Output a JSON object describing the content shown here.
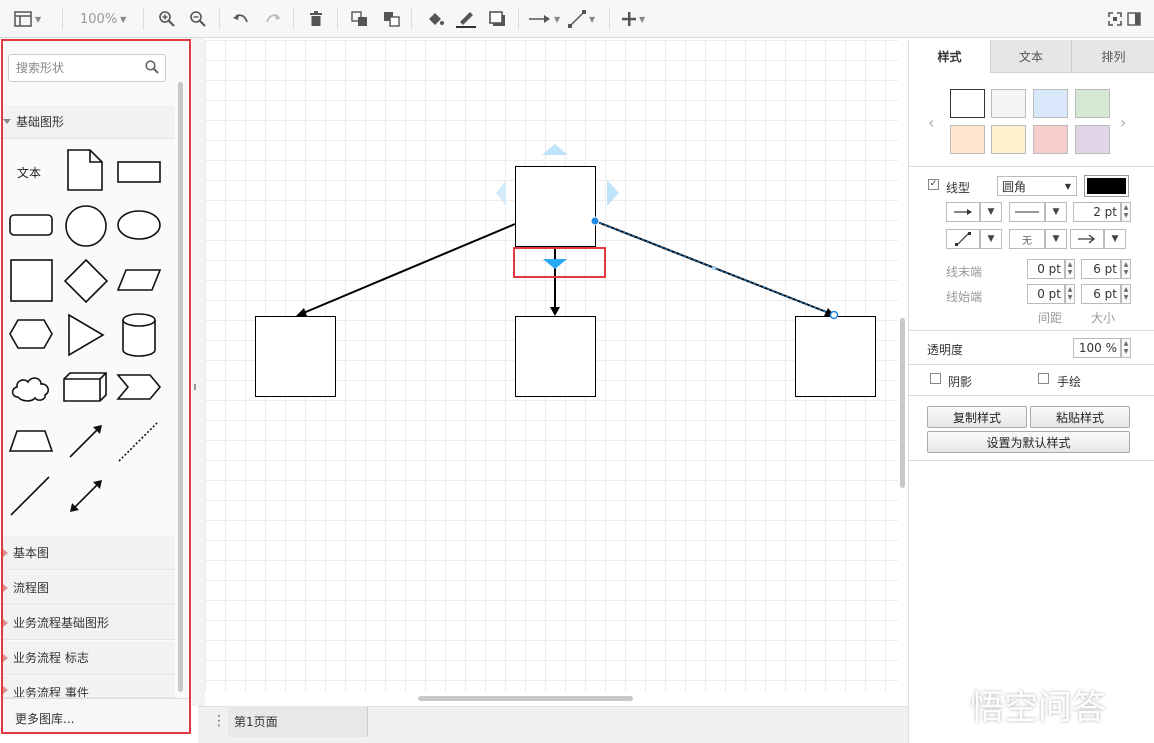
{
  "toolbar": {
    "zoom": "100%",
    "items": [
      "view-icon",
      "zoom-in-icon",
      "zoom-out-icon",
      "undo-icon",
      "redo-icon",
      "delete-icon",
      "to-front-icon",
      "to-back-icon",
      "fill-color-icon",
      "line-color-icon",
      "shadow-icon",
      "connection-icon",
      "waypoints-icon",
      "insert-icon",
      "fullscreen-icon",
      "format-panel-icon"
    ]
  },
  "left": {
    "search_placeholder": "搜索形状",
    "section_open": "基础图形",
    "text_shape": "文本",
    "sections": [
      "基本图",
      "流程图",
      "业务流程基础图形",
      "业务流程 标志",
      "业务流程 事件"
    ],
    "more": "更多图库..."
  },
  "bottom": {
    "page_tab": "第1页面"
  },
  "right": {
    "tabs": [
      "样式",
      "文本",
      "排列"
    ],
    "swatches": [
      "#ffffff",
      "#f5f5f5",
      "#dae8fc",
      "#d5e8d4",
      "#ffe6cc",
      "#fff2cc",
      "#f8cecc",
      "#e1d5e7"
    ],
    "line_label": "线型",
    "line_style": "圆角",
    "line_color": "#000000",
    "line_width": "2 pt",
    "waypoint_none": "无",
    "line_end_label": "线末端",
    "line_start_label": "线始端",
    "end_spacing": "0 pt",
    "end_size": "6 pt",
    "start_spacing": "0 pt",
    "start_size": "6 pt",
    "spacing_label": "间距",
    "size_label": "大小",
    "opacity_label": "透明度",
    "opacity": "100 %",
    "shadow_label": "阴影",
    "sketch_label": "手绘",
    "copy_style": "复制样式",
    "paste_style": "粘贴样式",
    "set_default": "设置为默认样式"
  },
  "watermark": "悟空问答"
}
